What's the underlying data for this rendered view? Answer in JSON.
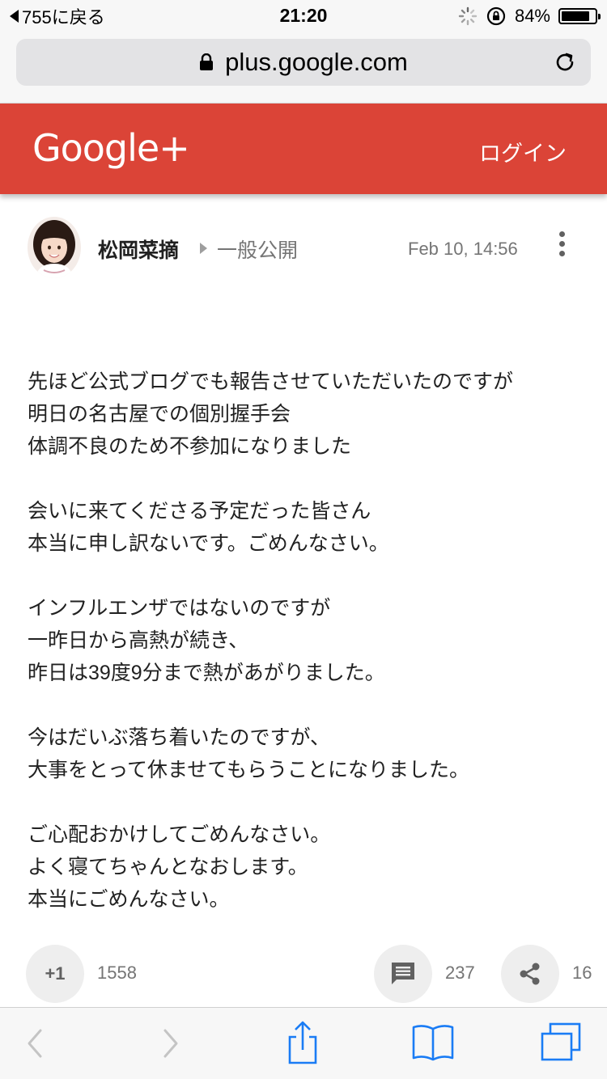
{
  "status_bar": {
    "back_label": "755に戻る",
    "time": "21:20",
    "battery": "84%",
    "battery_level": 0.84
  },
  "browser": {
    "url": "plus.google.com",
    "icons": [
      "lock-icon",
      "reload-icon"
    ]
  },
  "header": {
    "logo": "Google+",
    "login_label": "ログイン",
    "brand_color": "#db4437"
  },
  "post": {
    "author": "松岡菜摘",
    "visibility": "一般公開",
    "timestamp": "Feb 10, 14:56",
    "paragraphs": [
      {
        "lines": [
          "先ほど公式ブログでも報告させていただいたのですが",
          "明日の名古屋での個別握手会",
          "体調不良のため不参加になりました"
        ]
      },
      {
        "lines": [
          "会いに来てくださる予定だった皆さん",
          "本当に申し訳ないです。ごめんなさい。"
        ]
      },
      {
        "lines": [
          "インフルエンザではないのですが",
          "一昨日から高熱が続き、",
          "昨日は39度9分まで熱があがりました。"
        ]
      },
      {
        "lines": [
          "今はだいぶ落ち着いたのですが、",
          "大事をとって休ませてもらうことになりました。"
        ]
      },
      {
        "lines": [
          "ご心配おかけしてごめんなさい。",
          "よく寝てちゃんとなおします。",
          "本当にごめんなさい。"
        ]
      }
    ]
  },
  "actions": {
    "plusone_label": "+1",
    "plusone_count": "1558",
    "comment_count": "237",
    "share_count": "16"
  },
  "toolbar": {
    "icons": [
      "back-icon",
      "forward-icon",
      "share-icon",
      "bookmarks-icon",
      "tabs-icon"
    ],
    "accent": "#1a7cf5"
  }
}
